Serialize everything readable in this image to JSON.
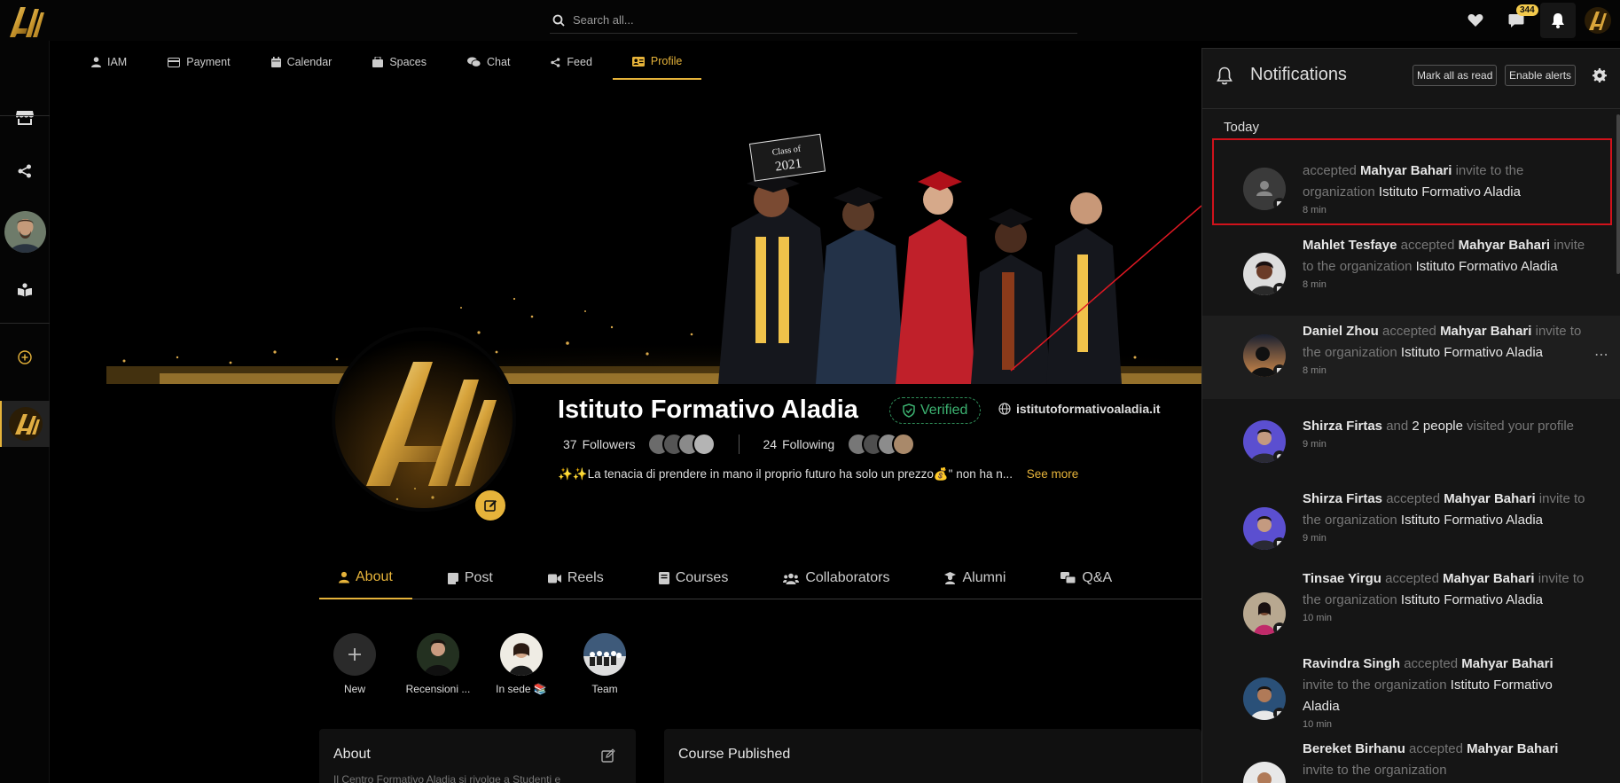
{
  "topbar": {
    "search_placeholder": "Search all...",
    "chat_badge": "344",
    "icons": [
      "heart-icon",
      "chat-icon",
      "bell-icon"
    ]
  },
  "sidebar": {
    "items": [
      "store-icon",
      "share-icon",
      "book-icon",
      "add-icon"
    ]
  },
  "main_tabs": [
    {
      "label": "IAM",
      "icon": "user-icon"
    },
    {
      "label": "Payment",
      "icon": "card-icon"
    },
    {
      "label": "Calendar",
      "icon": "calendar-icon"
    },
    {
      "label": "Spaces",
      "icon": "spaces-icon"
    },
    {
      "label": "Chat",
      "icon": "chat-icon"
    },
    {
      "label": "Feed",
      "icon": "share-icon"
    },
    {
      "label": "Profile",
      "icon": "id-card-icon",
      "active": true
    }
  ],
  "cover": {
    "board_line1": "Class of",
    "board_line2": "2021"
  },
  "profile": {
    "name": "Istituto Formativo Aladia",
    "verified_label": "Verified",
    "website": "istitutoformativoaladia.it",
    "followers_count": "37",
    "followers_label": "Followers",
    "following_count": "24",
    "following_label": "Following",
    "bio": "✨✨La tenacia di prendere in mano il proprio futuro ha solo un prezzo💰\" non ha n...",
    "see_more": "See more"
  },
  "profile_tabs": [
    {
      "label": "About",
      "active": true
    },
    {
      "label": "Post"
    },
    {
      "label": "Reels"
    },
    {
      "label": "Courses"
    },
    {
      "label": "Collaborators"
    },
    {
      "label": "Alumni"
    },
    {
      "label": "Q&A"
    }
  ],
  "highlights": [
    {
      "label": "New"
    },
    {
      "label": "Recensioni ..."
    },
    {
      "label": "In sede 📚"
    },
    {
      "label": "Team"
    }
  ],
  "cards": {
    "about_title": "About",
    "about_preview": "Il Centro Formativo Aladia si rivolge a Studenti e",
    "course_title": "Course Published"
  },
  "notifications": {
    "title": "Notifications",
    "mark_all_read": "Mark all as read",
    "enable_alerts": "Enable alerts",
    "section": "Today",
    "items": [
      {
        "actor": "",
        "verb": " accepted ",
        "target": "Mahyar Bahari",
        "mid": " invite to the organization ",
        "org": "Istituto Formativo Aladia",
        "time": "8 min"
      },
      {
        "actor": "Mahlet Tesfaye",
        "verb": " accepted ",
        "target": "Mahyar Bahari",
        "mid": " invite to the organization ",
        "org": "Istituto Formativo Aladia",
        "time": "8 min"
      },
      {
        "actor": "Daniel Zhou",
        "verb": " accepted ",
        "target": "Mahyar Bahari",
        "mid": " invite to the organization ",
        "org": "Istituto Formativo Aladia",
        "time": "8 min"
      },
      {
        "actor": "Shirza Firtas",
        "verb": " and ",
        "target": "2 people",
        "mid": " visited your profile",
        "org": "",
        "time": "9 min"
      },
      {
        "actor": "Shirza Firtas",
        "verb": " accepted ",
        "target": "Mahyar Bahari",
        "mid": " invite to the organization ",
        "org": "Istituto Formativo Aladia",
        "time": "9 min"
      },
      {
        "actor": "Tinsae Yirgu",
        "verb": " accepted ",
        "target": "Mahyar Bahari",
        "mid": " invite to the organization ",
        "org": "Istituto Formativo Aladia",
        "time": "10 min"
      },
      {
        "actor": "Ravindra Singh",
        "verb": " accepted ",
        "target": "Mahyar Bahari",
        "mid": " invite to the organization ",
        "org": "Istituto Formativo Aladia",
        "time": "10 min"
      },
      {
        "actor": "Bereket Birhanu",
        "verb": " accepted ",
        "target": "Mahyar Bahari",
        "mid": " invite to the organization",
        "org": "",
        "time": ""
      }
    ]
  },
  "colors": {
    "accent": "#e6b33a",
    "verified": "#3cb371",
    "annotation": "#d0121b"
  }
}
